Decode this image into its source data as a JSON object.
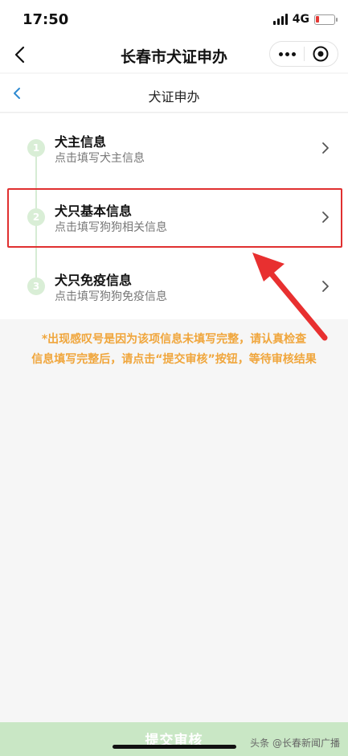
{
  "status_bar": {
    "time": "17:50",
    "network": "4G",
    "battery_level": 0.2,
    "battery_color": "#e53935"
  },
  "nav": {
    "title": "长春市犬证申办",
    "back_icon": "chevron-left-icon",
    "more_icon": "more-dots-icon",
    "close_icon": "target-close-icon"
  },
  "sub_header": {
    "title": "犬证申办",
    "back_icon": "chevron-left-icon",
    "accent": "#2f8ad1"
  },
  "steps": [
    {
      "number": "1",
      "title": "犬主信息",
      "subtitle": "点击填写犬主信息"
    },
    {
      "number": "2",
      "title": "犬只基本信息",
      "subtitle": "点击填写狗狗相关信息"
    },
    {
      "number": "3",
      "title": "犬只免疫信息",
      "subtitle": "点击填写狗狗免疫信息"
    }
  ],
  "notices": {
    "line1": "*出现感叹号是因为该项信息未填写完整，请认真检查",
    "line2": "信息填写完整后，请点击“提交审核”按钮，等待审核结果",
    "color": "#f0a63c"
  },
  "submit": {
    "label": "提交审核",
    "color": "#c9e7c5"
  },
  "watermark": {
    "text": "头条 @长春新闻广播"
  }
}
